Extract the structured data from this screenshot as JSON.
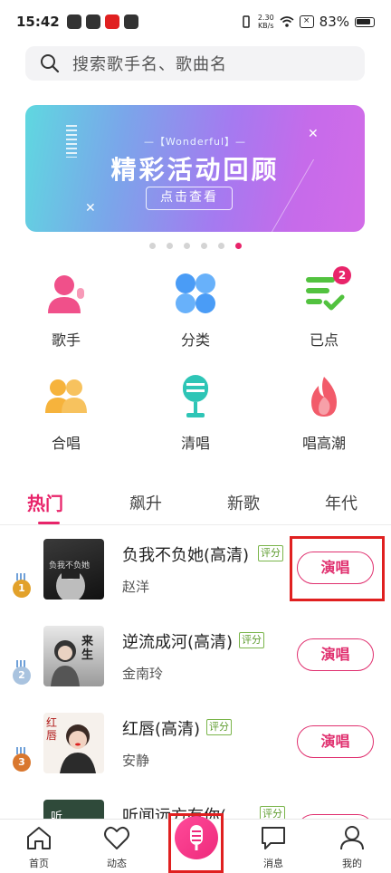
{
  "status_bar": {
    "time": "15:42",
    "net_speed_top": "2.30",
    "net_speed_bottom": "KB/s",
    "battery": "83%"
  },
  "search": {
    "placeholder": "搜索歌手名、歌曲名",
    "icon": "search-icon"
  },
  "banner": {
    "subtitle": "—【Wonderful】—",
    "title": "精彩活动回顾",
    "cta": "点击查看",
    "page_count": 6,
    "active_page": 6
  },
  "categories": [
    {
      "label": "歌手",
      "icon": "singer-icon"
    },
    {
      "label": "分类",
      "icon": "category-icon"
    },
    {
      "label": "已点",
      "icon": "ordered-list-icon",
      "badge": "2"
    },
    {
      "label": "合唱",
      "icon": "duet-icon"
    },
    {
      "label": "清唱",
      "icon": "microphone-icon"
    },
    {
      "label": "唱高潮",
      "icon": "flame-icon"
    }
  ],
  "tabs": [
    {
      "label": "热门",
      "active": true
    },
    {
      "label": "飙升",
      "active": false
    },
    {
      "label": "新歌",
      "active": false
    },
    {
      "label": "年代",
      "active": false
    }
  ],
  "songs": [
    {
      "rank": "1",
      "title": "负我不负她(高清)",
      "rate_tag": "评分",
      "singer": "赵洋",
      "action": "演唱",
      "cover_text": "负我不负她"
    },
    {
      "rank": "2",
      "title": "逆流成河(高清)",
      "rate_tag": "评分",
      "singer": "金南玲",
      "action": "演唱",
      "cover_text": "来生"
    },
    {
      "rank": "3",
      "title": "红唇(高清)",
      "rate_tag": "评分",
      "singer": "安静",
      "action": "演唱",
      "cover_text": "红唇"
    },
    {
      "rank": "",
      "title": "听闻远方有你(…",
      "rate_tag": "评分",
      "singer": "",
      "action": "演唱",
      "cover_text": "听"
    }
  ],
  "bottom_nav": [
    {
      "label": "首页",
      "icon": "home-icon"
    },
    {
      "label": "动态",
      "icon": "heart-icon"
    },
    {
      "label": "",
      "icon": "microphone-icon"
    },
    {
      "label": "消息",
      "icon": "message-icon"
    },
    {
      "label": "我的",
      "icon": "profile-icon"
    }
  ],
  "colors": {
    "accent": "#e8246a",
    "rating_tag": "#5f9c2f",
    "highlight_box": "#e02020"
  }
}
